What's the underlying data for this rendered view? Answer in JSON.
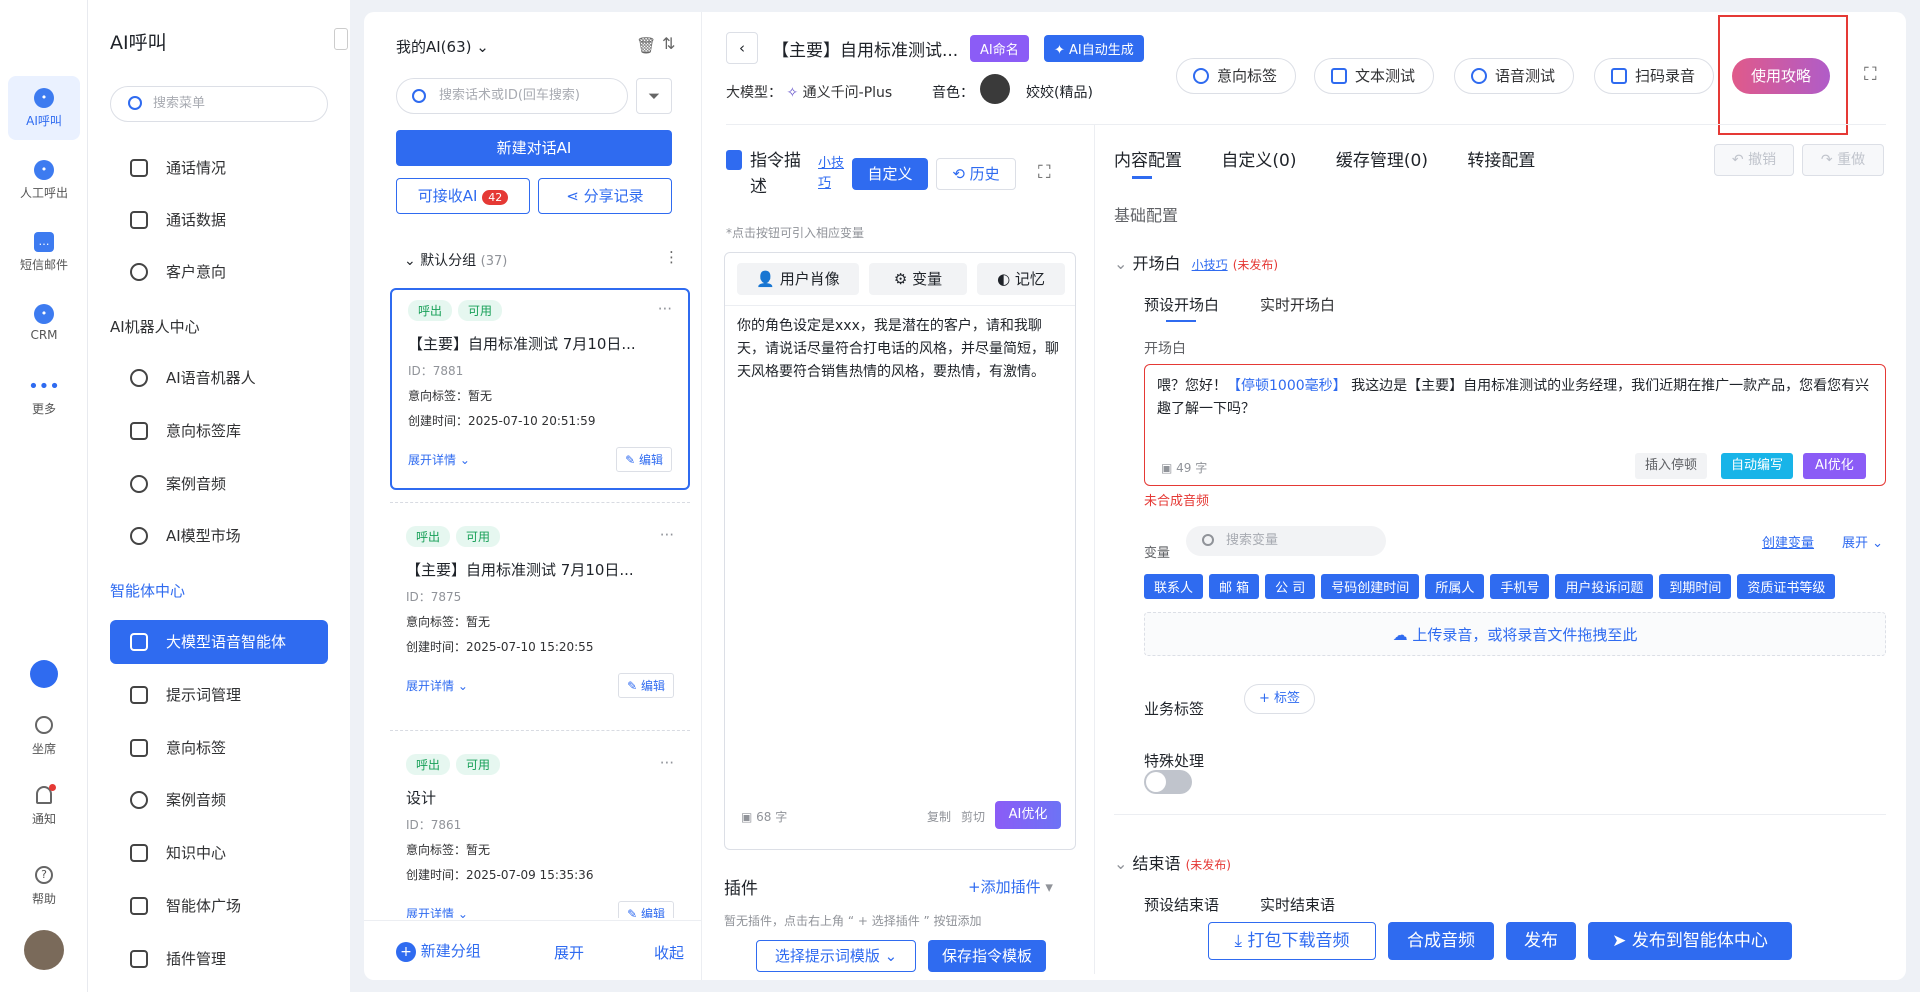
{
  "rail": {
    "items": [
      {
        "label": "AI呼叫",
        "icon": "ai-call-icon"
      },
      {
        "label": "人工呼出",
        "icon": "manual-call-icon"
      },
      {
        "label": "短信邮件",
        "icon": "sms-mail-icon"
      },
      {
        "label": "CRM",
        "icon": "crm-icon"
      },
      {
        "label": "更多",
        "icon": "more-icon"
      }
    ],
    "bottom": [
      {
        "label": "坐席",
        "icon": "headset-icon"
      },
      {
        "label": "通知",
        "icon": "bell-icon"
      },
      {
        "label": "帮助",
        "icon": "help-icon"
      }
    ]
  },
  "menu": {
    "title": "AI呼叫",
    "search_placeholder": "搜索菜单",
    "items_a": [
      "通话情况",
      "通话数据",
      "客户意向"
    ],
    "section_robot": "AI机器人中心",
    "items_b": [
      "AI语音机器人",
      "意向标签库",
      "案例音频",
      "AI模型市场"
    ],
    "section_agent": "智能体中心",
    "items_c": [
      "大模型语音智能体",
      "提示词管理",
      "意向标签",
      "案例音频",
      "知识中心",
      "智能体广场",
      "插件管理"
    ]
  },
  "list": {
    "header": "我的AI(63)",
    "search_placeholder": "搜索话术或ID(回车搜索)",
    "new_btn": "新建对话AI",
    "receivable": "可接收AI",
    "receivable_count": "42",
    "share": "分享记录",
    "group": "默认分组",
    "group_count": "(37)",
    "cards": [
      {
        "tag1": "呼出",
        "tag2": "可用",
        "title": "【主要】自用标准测试 7月10日...",
        "id": "ID：7881",
        "intent": "意向标签：暂无",
        "created": "创建时间：2025-07-10 20:51:59",
        "expand": "展开详情",
        "edit": "编辑"
      },
      {
        "tag1": "呼出",
        "tag2": "可用",
        "title": "【主要】自用标准测试 7月10日...",
        "id": "ID：7875",
        "intent": "意向标签：暂无",
        "created": "创建时间：2025-07-10 15:20:55",
        "expand": "展开详情",
        "edit": "编辑"
      },
      {
        "tag1": "呼出",
        "tag2": "可用",
        "title": "设计",
        "id": "ID：7861",
        "intent": "意向标签：暂无",
        "created": "创建时间：2025-07-09 15:35:36",
        "expand": "展开详情",
        "edit": "编辑"
      }
    ],
    "footer": {
      "new_group": "新建分组",
      "expand": "展开",
      "collapse": "收起"
    }
  },
  "header": {
    "title": "【主要】自用标准测试...",
    "ai_name": "AI命名",
    "ai_auto": "AI自动生成",
    "model_label": "大模型：",
    "model_value": "通义千问-Plus",
    "voice_label": "音色：",
    "voice_value": "姣姣(精品)",
    "btn_intent": "意向标签",
    "btn_text_test": "文本测试",
    "btn_voice_test": "语音测试",
    "btn_scan": "扫码录音",
    "btn_guide": "使用攻略"
  },
  "instr": {
    "title": "指令描述",
    "tip": "小技巧",
    "custom": "自定义",
    "history": "历史",
    "hint": "*点击按钮可引入相应变量",
    "tab_persona": "用户肖像",
    "tab_var": "变量",
    "tab_memory": "记忆",
    "content": "你的角色设定是xxx，我是潜在的客户，请和我聊天，请说话尽量符合打电话的风格，并尽量简短，聊天风格要符合销售热情的风格，要热情，有激情。",
    "count": "68 字",
    "copy": "复制",
    "cut": "剪切",
    "ai_opt": "AI优化",
    "plugin": "插件",
    "add_plugin": "+添加插件",
    "plugin_hint": "暂无插件，点击右上角 “ + 选择插件 ” 按钮添加",
    "select_tpl": "选择提示词模版",
    "save_tpl": "保存指令模板"
  },
  "config": {
    "tabs": [
      "内容配置",
      "自定义(0)",
      "缓存管理(0)",
      "转接配置"
    ],
    "undo": "撤销",
    "redo": "重做",
    "basic": "基础配置",
    "opening": "开场白",
    "tip": "小技巧",
    "unpublished": "(未发布)",
    "preset_opening": "预设开场白",
    "realtime_opening": "实时开场白",
    "opening_label": "开场白",
    "opening_pre": "喂？您好！",
    "opening_pause": "【停顿1000毫秒】",
    "opening_post": " 我这边是【主要】自用标准测试的业务经理，我们近期在推广一款产品，您看您有兴趣了解一下吗？",
    "opening_count": "49 字",
    "insert_pause": "插入停顿",
    "auto_write": "自动编写",
    "ai_opt": "AI优化",
    "not_synth": "未合成音频",
    "var_label": "变量",
    "var_search": "搜索变量",
    "create_var": "创建变量",
    "expand": "展开",
    "vars": [
      "联系人",
      "邮 箱",
      "公 司",
      "号码创建时间",
      "所属人",
      "手机号",
      "用户投诉问题",
      "到期时间",
      "资质证书等级"
    ],
    "upload": "上传录音，或将录音文件拖拽至此",
    "biz_tag": "业务标签",
    "add_tag": "标签",
    "special": "特殊处理",
    "ending": "结束语",
    "preset_ending": "预设结束语",
    "realtime_ending": "实时结束语"
  },
  "bottom": {
    "download": "打包下载音频",
    "synth": "合成音频",
    "publish": "发布",
    "publish_center": "发布到智能体中心"
  },
  "colors": {
    "primary": "#2f6bf0",
    "purple": "#8b5cf6",
    "guide": "#d65a8f",
    "highlight_box": "#e53935"
  }
}
